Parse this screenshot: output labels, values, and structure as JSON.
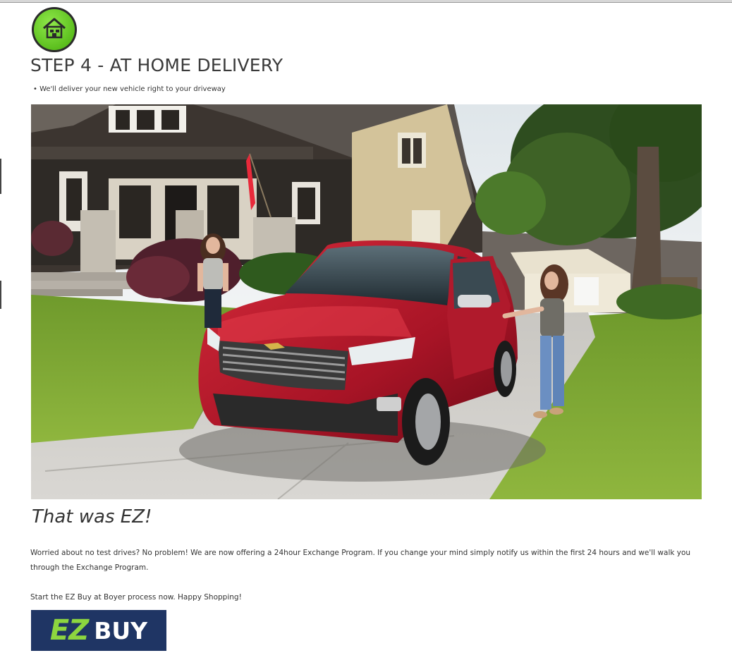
{
  "step": {
    "icon": "house-icon",
    "title": "STEP 4 - AT HOME DELIVERY",
    "bullet": "• We'll deliver your new vehicle right to your driveway"
  },
  "photo": {
    "subject": "red-suv-in-driveway-photo"
  },
  "content": {
    "subheading": "That was EZ!",
    "paragraph": "Worried about no test drives? No problem! We are now offering a 24hour Exchange Program. If you change your mind simply notify us within the first 24 hours and we'll walk you through the Exchange Program.",
    "cta_text": "Start the EZ Buy at Boyer process now. Happy Shopping!"
  },
  "logo": {
    "ez": "EZ",
    "buy": "BUY"
  },
  "colors": {
    "icon_green": "#6fd22d",
    "logo_navy": "#1f3564",
    "logo_green": "#8dd63f",
    "text": "#333333"
  }
}
